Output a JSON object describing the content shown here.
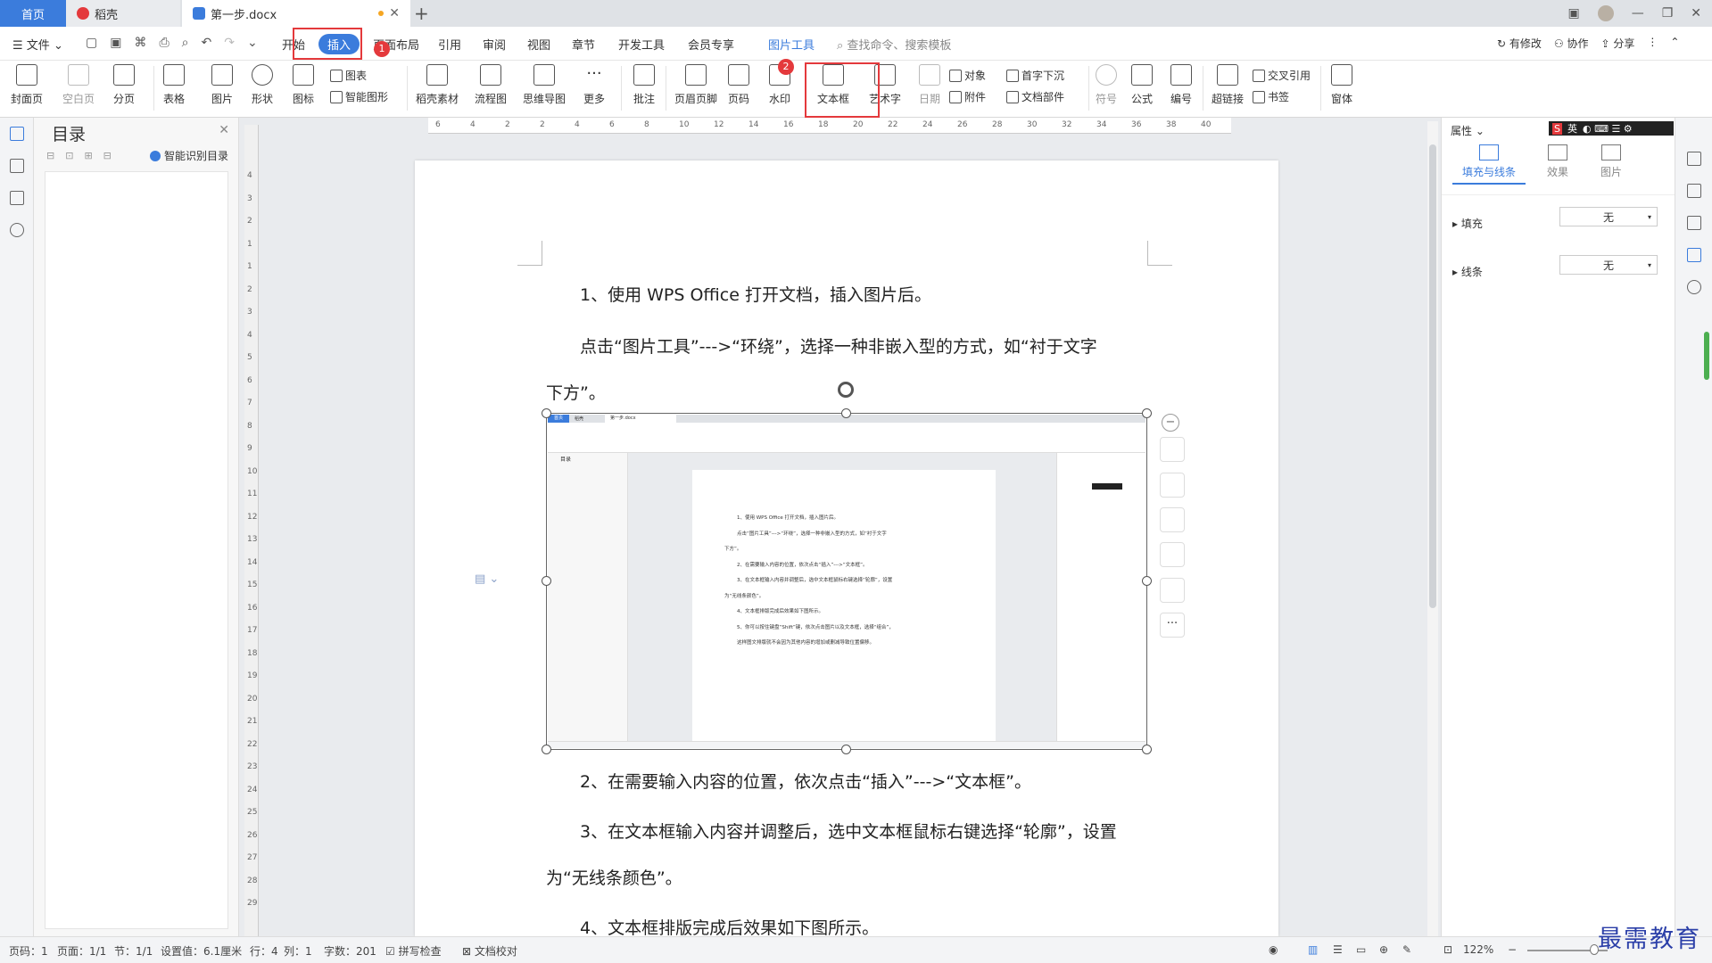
{
  "titlebar": {
    "tabs": [
      "首页",
      "稻壳",
      "第一步.docx"
    ]
  },
  "menubar": {
    "file": "文件",
    "items": [
      "开始",
      "插入",
      "页面布局",
      "引用",
      "审阅",
      "视图",
      "章节",
      "开发工具",
      "会员专享",
      "图片工具"
    ],
    "search": "查找命令、搜索模板",
    "right": [
      "有修改",
      "协作",
      "分享"
    ]
  },
  "ribbon": {
    "large": [
      "封面页",
      "空白页",
      "分页",
      "表格",
      "图片",
      "形状",
      "图标",
      "稻壳素材",
      "流程图",
      "思维导图",
      "更多",
      "批注",
      "页眉页脚",
      "页码",
      "水印",
      "文本框",
      "艺术字",
      "日期",
      "符号",
      "公式",
      "编号",
      "超链接",
      "窗体"
    ],
    "small": [
      "图表",
      "智能图形",
      "对象",
      "附件",
      "首字下沉",
      "文档部件",
      "交叉引用",
      "书签"
    ]
  },
  "badges": [
    "1",
    "2"
  ],
  "outline": {
    "title": "目录",
    "smart": "智能识别目录"
  },
  "document": {
    "lines": [
      "1、使用 WPS Office 打开文档，插入图片后。",
      "点击“图片工具”--->“环绕”，选择一种非嵌入型的方式，如“衬于文字",
      "下方”。",
      "2、在需要输入内容的位置，依次点击“插入”--->“文本框”。",
      "3、在文本框输入内容并调整后，选中文本框鼠标右键选择“轮廓”，设置",
      "为“无线条颜色”。",
      "4、文本框排版完成后效果如下图所示。"
    ]
  },
  "mini_doc": {
    "tabs": [
      "首页",
      "稻壳",
      "第一步.docx"
    ],
    "outline_title": "目录",
    "lines": [
      "1、使用 WPS Office 打开文档，插入图片后。",
      "点击“图片工具”--->“环绕”，选择一种非嵌入型的方式，如“衬于文字",
      "下方”。",
      "2、在需要输入内容的位置，依次点击“插入”--->“文本框”。",
      "3、在文本框输入内容并调整后，选中文本框鼠标右键选择“轮廓”，设置",
      "为“无线条颜色”。",
      "4、文本框排版完成后效果如下图所示。",
      "5、你可以按住键盘“Shift”键，依次点击图片以及文本框，选择“组合”，",
      "这样图文排版就不会因为其他内容的增加或删减导致位置偏移。"
    ]
  },
  "properties": {
    "header": "属性",
    "tabs": [
      "填充与线条",
      "效果",
      "图片"
    ],
    "fill_label": "填充",
    "fill_value": "无",
    "line_label": "线条",
    "line_value": "无"
  },
  "ime": "英",
  "status": {
    "items": [
      "页码：1",
      "页面：1/1",
      "节：1/1",
      "设置值：6.1厘米",
      "行：4",
      "列：1",
      "字数：201",
      "拼写检查",
      "文档校对"
    ],
    "zoom": "122%"
  },
  "ruler": {
    "h": [
      "6",
      "4",
      "2",
      "2",
      "4",
      "6",
      "8",
      "10",
      "12",
      "14",
      "16",
      "18",
      "20",
      "22",
      "24",
      "26",
      "28",
      "30",
      "32",
      "34",
      "36",
      "38",
      "40"
    ],
    "v": [
      "4",
      "3",
      "2",
      "1",
      "1",
      "2",
      "3",
      "4",
      "5",
      "6",
      "7",
      "8",
      "9",
      "10",
      "11",
      "12",
      "13",
      "14",
      "15",
      "16",
      "17",
      "18",
      "19",
      "20",
      "21",
      "22",
      "23",
      "24",
      "25",
      "26",
      "27",
      "28",
      "29"
    ]
  },
  "watermark": "最需教育",
  "colors": {
    "accent": "#3b7cdc",
    "highlight": "#e4393c"
  }
}
